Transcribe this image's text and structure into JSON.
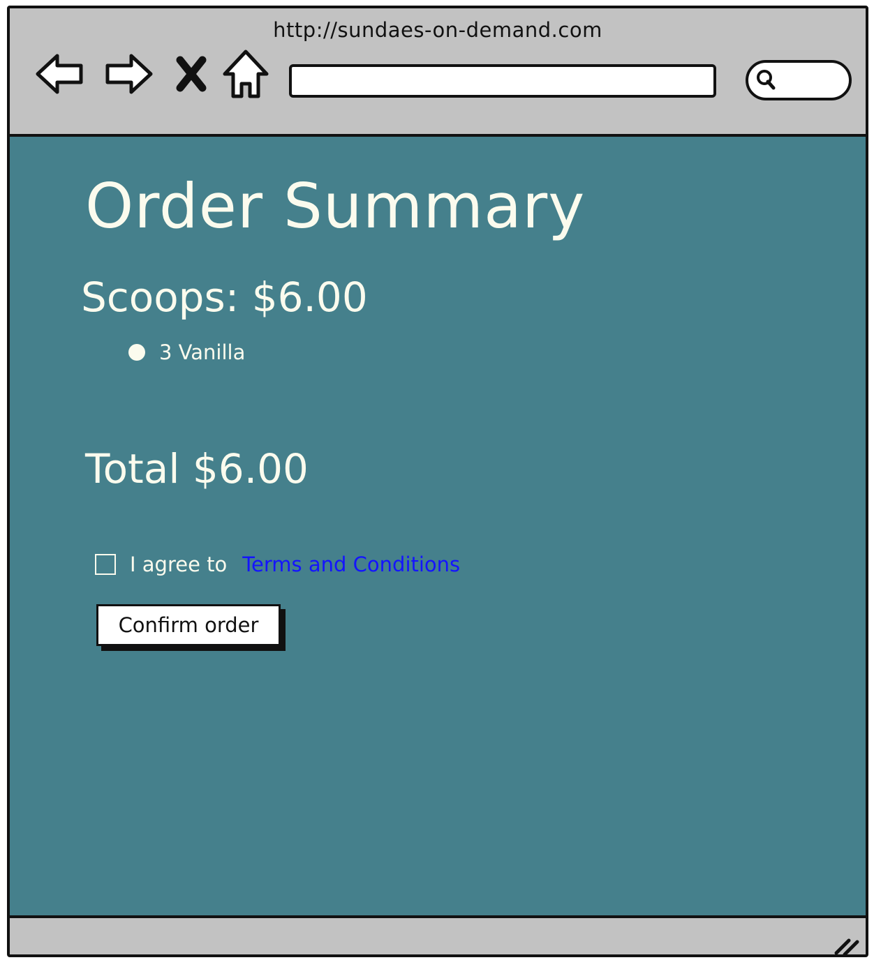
{
  "browser": {
    "url": "http://sundaes-on-demand.com",
    "address_value": "",
    "search_value": "",
    "icons": {
      "back": "back-arrow-icon",
      "forward": "forward-arrow-icon",
      "stop": "close-icon",
      "home": "home-icon",
      "search": "search-icon",
      "resize": "resize-grip-icon"
    }
  },
  "page": {
    "title": "Order Summary",
    "scoops_heading": "Scoops: $6.00",
    "scoops_items": [
      {
        "label": "3 Vanilla"
      }
    ],
    "total": "Total $6.00",
    "terms": {
      "checked": false,
      "agree_text": "I agree to",
      "link_text": "Terms and Conditions"
    },
    "confirm_label": "Confirm order"
  },
  "colors": {
    "content_background": "#45808c",
    "chrome_gray": "#c2c2c2",
    "text_light": "#fbfbee",
    "link_blue": "#1414ff",
    "outline": "#111111"
  }
}
